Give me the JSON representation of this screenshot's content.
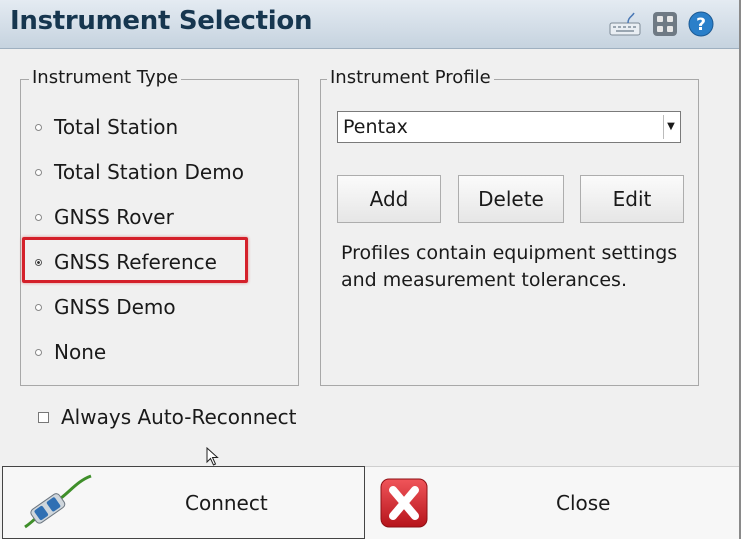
{
  "window": {
    "title": "Instrument Selection"
  },
  "titlebar_icons": [
    "keyboard-icon",
    "calculator-icon",
    "help-icon"
  ],
  "instrument_type": {
    "legend": "Instrument Type",
    "options": [
      {
        "label": "Total Station",
        "selected": false
      },
      {
        "label": "Total Station Demo",
        "selected": false
      },
      {
        "label": "GNSS Rover",
        "selected": false
      },
      {
        "label": "GNSS Reference",
        "selected": true
      },
      {
        "label": "GNSS Demo",
        "selected": false
      },
      {
        "label": "None",
        "selected": false
      }
    ]
  },
  "instrument_profile": {
    "legend": "Instrument Profile",
    "selected_value": "Pentax",
    "add_label": "Add",
    "delete_label": "Delete",
    "edit_label": "Edit",
    "description": "Profiles contain equipment settings and measurement tolerances."
  },
  "auto_reconnect": {
    "label": "Always Auto-Reconnect",
    "checked": false
  },
  "footer": {
    "connect_label": "Connect",
    "close_label": "Close"
  },
  "colors": {
    "highlight": "#d4202a",
    "title_text": "#16364f",
    "close_red": "#d7262b"
  }
}
